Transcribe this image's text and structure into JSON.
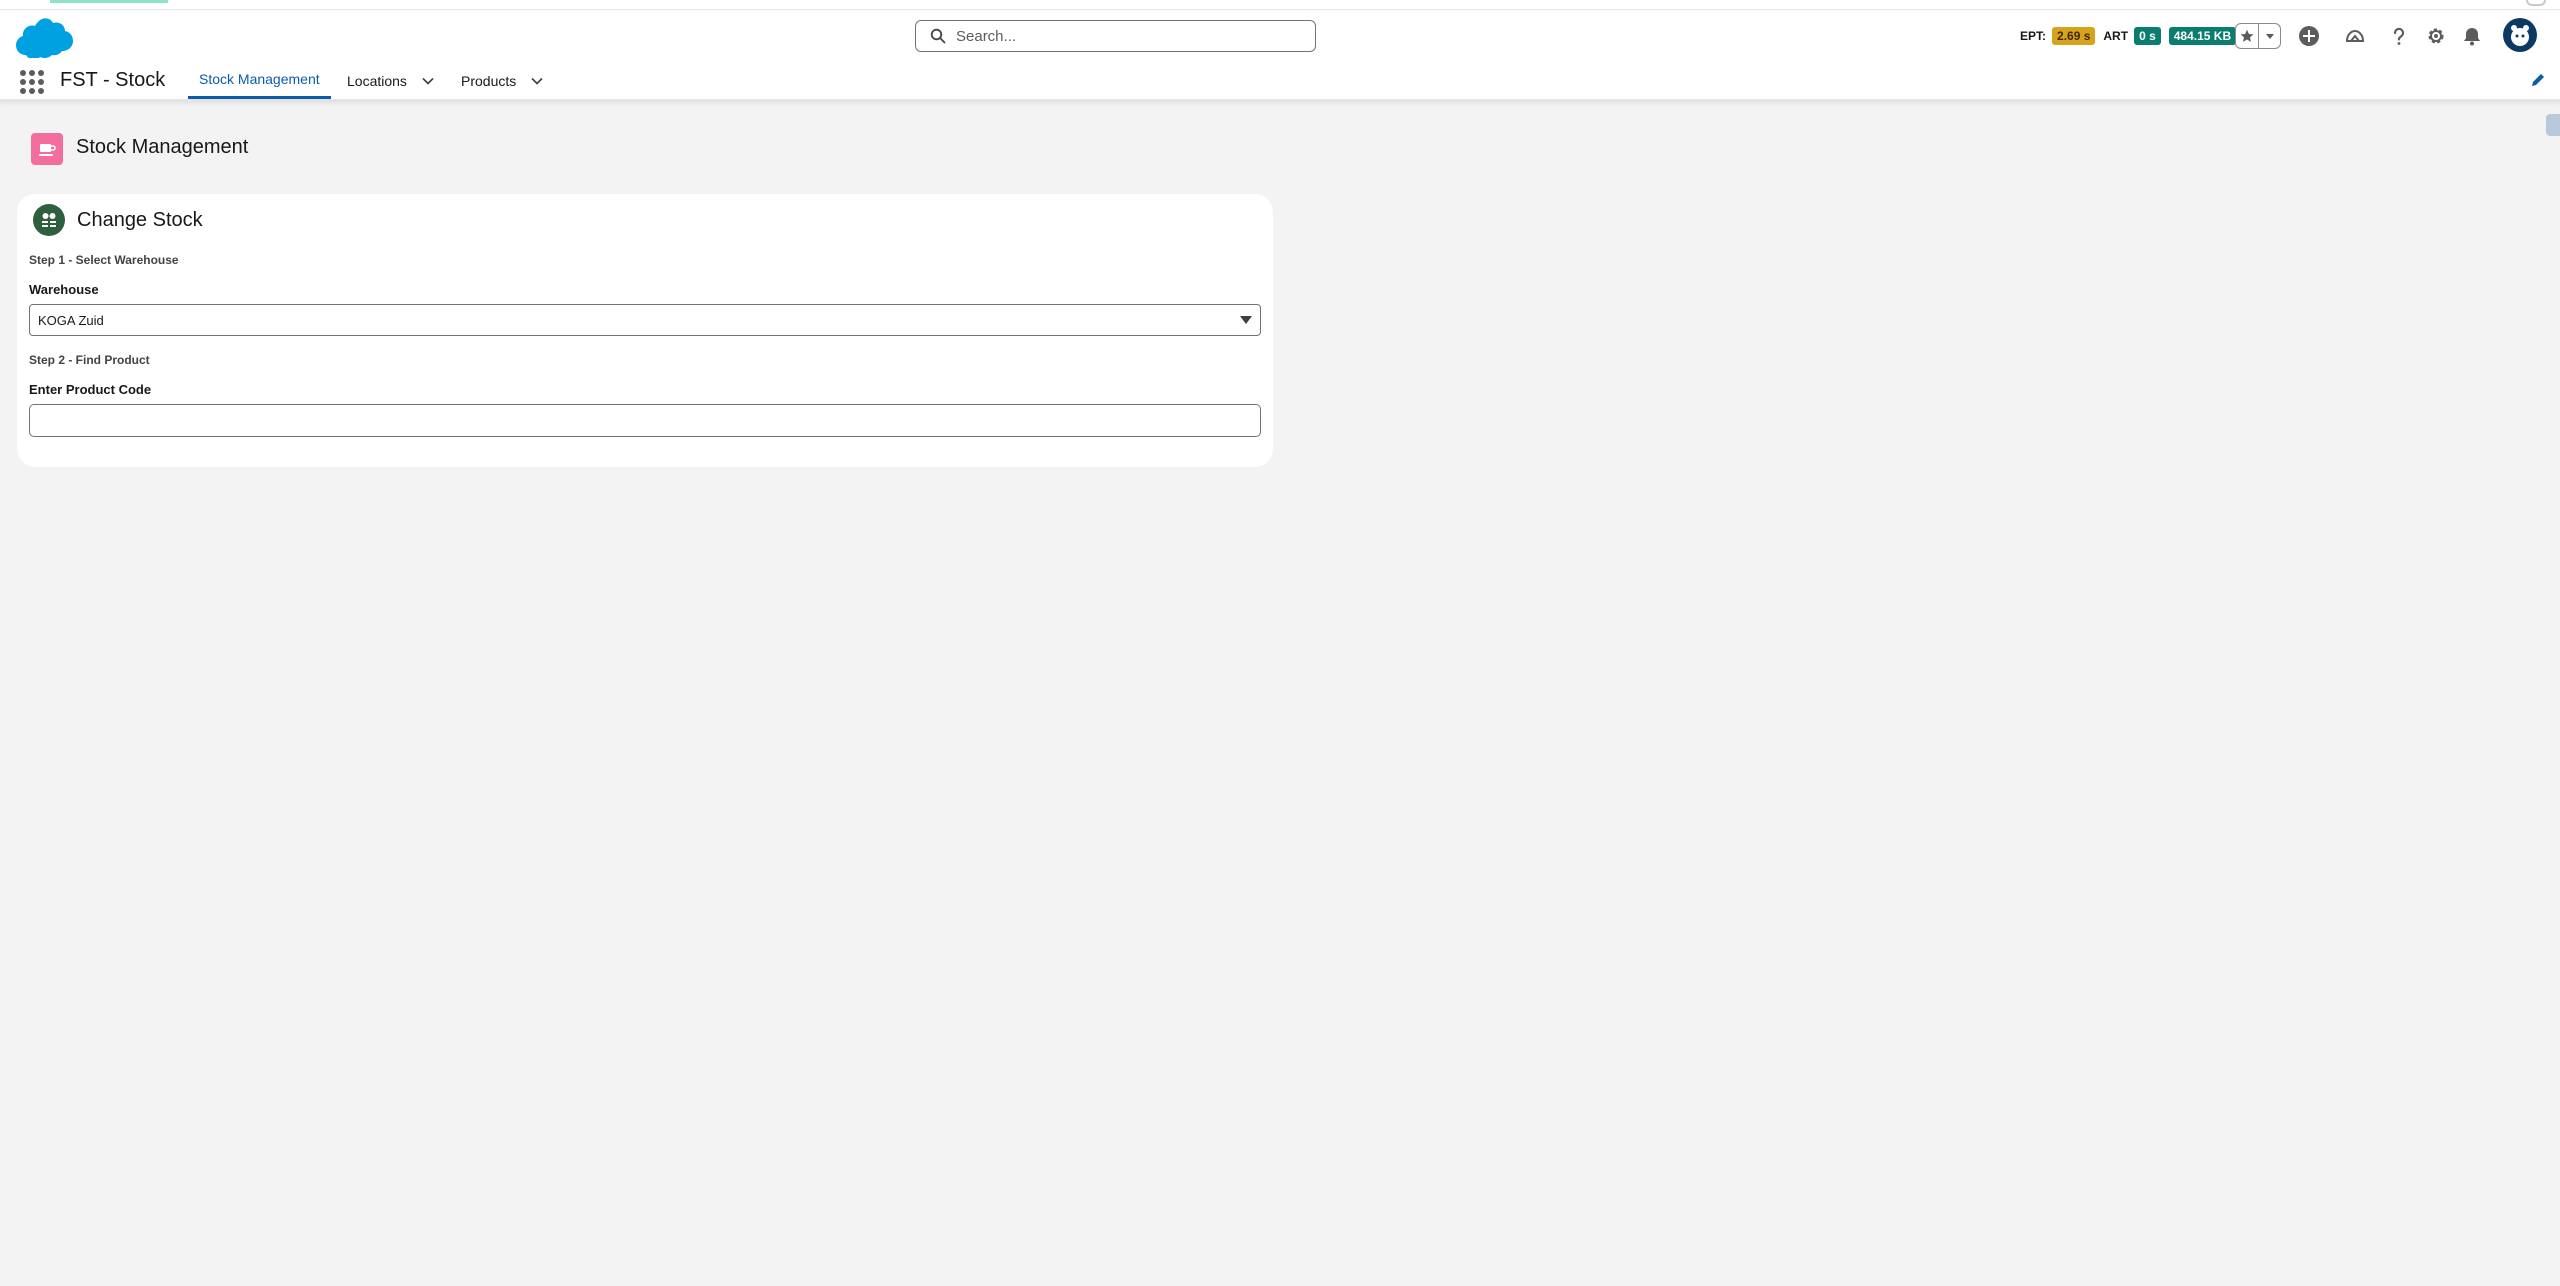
{
  "header": {
    "search_placeholder": "Search...",
    "perf": {
      "ept_label": "EPT:",
      "ept_value": "2.69 s",
      "art_label": "ART",
      "art_value": "0 s",
      "size_value": "484.15 KB"
    },
    "icons": [
      "salesforce-cloud-logo",
      "search-icon",
      "star-icon",
      "chevron-down-icon",
      "add-icon",
      "trailhead-icon",
      "help-icon",
      "gear-icon",
      "bell-icon",
      "avatar"
    ]
  },
  "nav": {
    "app_name": "FST - Stock",
    "items": [
      {
        "label": "Stock Management",
        "active": true
      },
      {
        "label": "Locations",
        "dropdown": true
      },
      {
        "label": "Products",
        "dropdown": true
      }
    ]
  },
  "page": {
    "title": "Stock Management"
  },
  "card": {
    "title": "Change Stock",
    "step1": "Step 1 - Select Warehouse",
    "warehouse_label": "Warehouse",
    "warehouse_value": "KOGA Zuid",
    "step2": "Step 2 - Find Product",
    "product_code_label": "Enter Product Code",
    "product_code_value": ""
  },
  "colors": {
    "brand_blue": "#0b5cab",
    "salesforce_cloud": "#00a1e0",
    "page_icon": "#f36e9c",
    "card_icon": "#2e5f3e",
    "ept_badge": "#d8a21c",
    "art_badge": "#0b7d6f"
  }
}
